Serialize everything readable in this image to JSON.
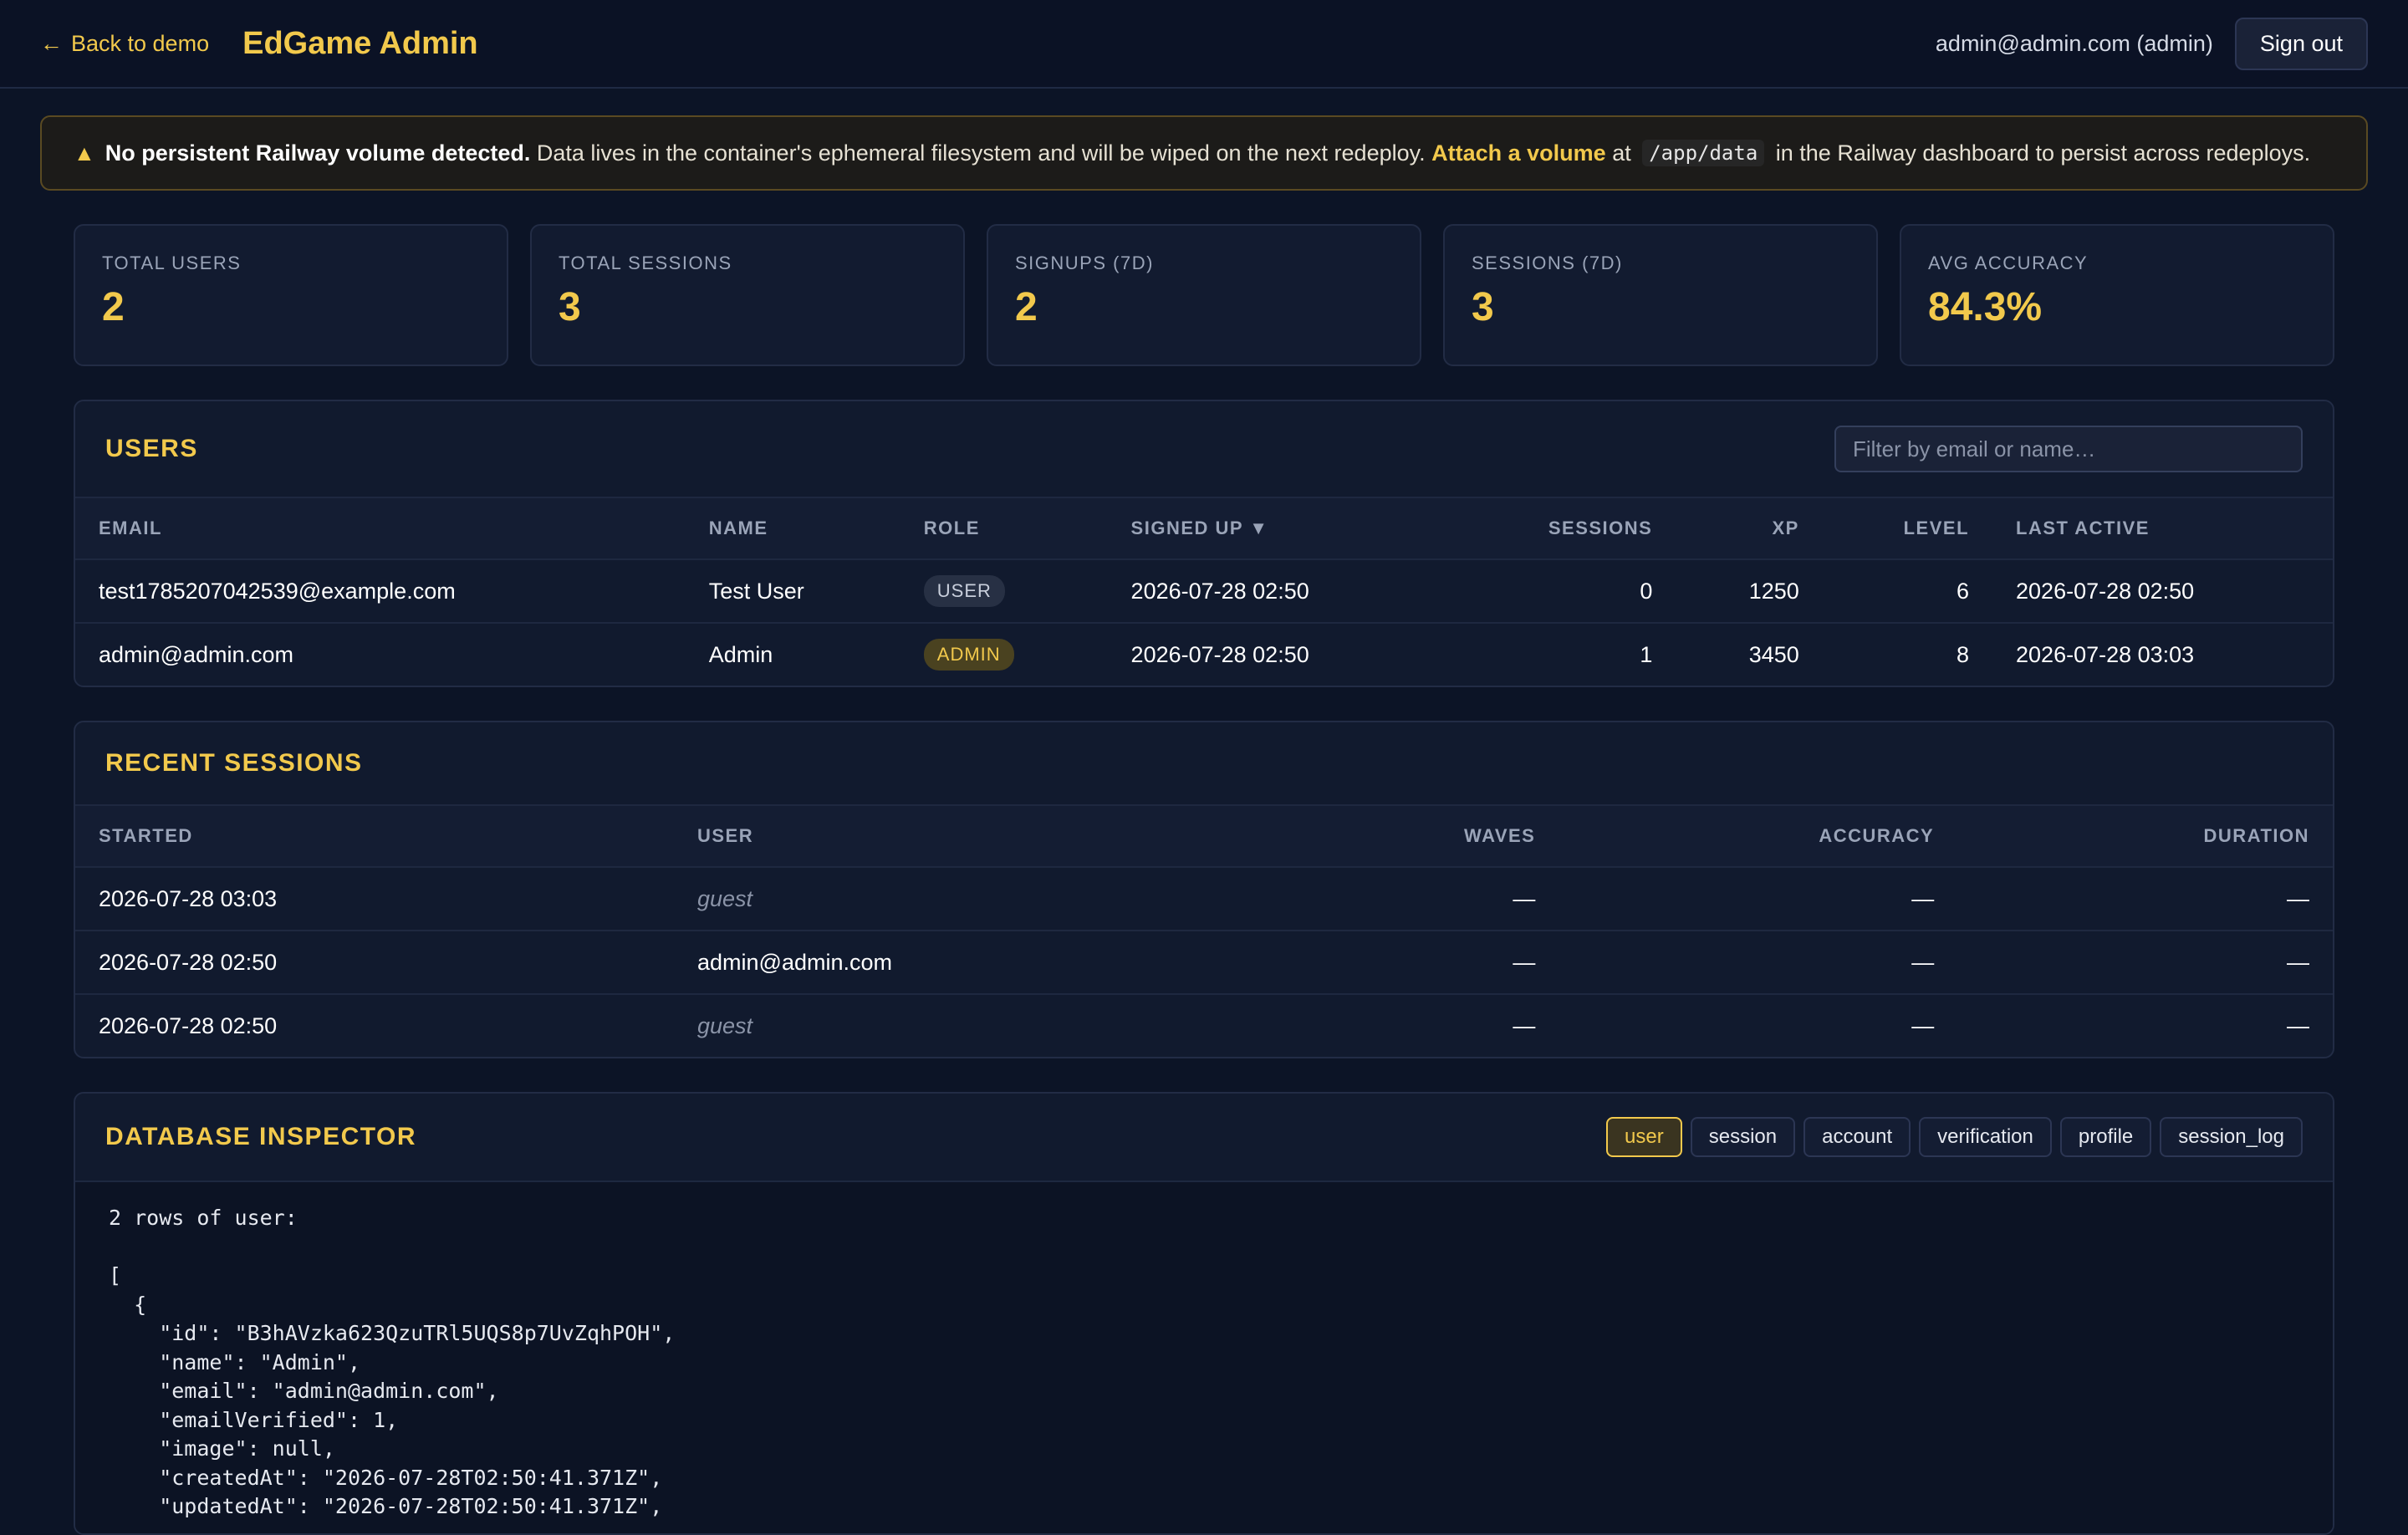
{
  "header": {
    "back_label": "Back to demo",
    "title": "EdGame Admin",
    "user_label": "admin@admin.com (admin)",
    "signout_label": "Sign out"
  },
  "banner": {
    "bold": "No persistent Railway volume detected.",
    "text1": " Data lives in the container's ephemeral filesystem and will be wiped on the next redeploy. ",
    "link": "Attach a volume",
    "text2": " at ",
    "code": "/app/data",
    "text3": " in the Railway dashboard to persist across redeploys."
  },
  "stats": [
    {
      "label": "TOTAL USERS",
      "value": "2"
    },
    {
      "label": "TOTAL SESSIONS",
      "value": "3"
    },
    {
      "label": "SIGNUPS (7D)",
      "value": "2"
    },
    {
      "label": "SESSIONS (7D)",
      "value": "3"
    },
    {
      "label": "AVG ACCURACY",
      "value": "84.3%"
    }
  ],
  "users": {
    "title": "USERS",
    "filter_placeholder": "Filter by email or name…",
    "columns": [
      "EMAIL",
      "NAME",
      "ROLE",
      "SIGNED UP ▼",
      "SESSIONS",
      "XP",
      "LEVEL",
      "LAST ACTIVE"
    ],
    "rows": [
      {
        "email": "test1785207042539@example.com",
        "name": "Test User",
        "role": "USER",
        "signed_up": "2026-07-28 02:50",
        "sessions": "0",
        "xp": "1250",
        "level": "6",
        "last_active": "2026-07-28 02:50"
      },
      {
        "email": "admin@admin.com",
        "name": "Admin",
        "role": "ADMIN",
        "signed_up": "2026-07-28 02:50",
        "sessions": "1",
        "xp": "3450",
        "level": "8",
        "last_active": "2026-07-28 03:03"
      }
    ]
  },
  "sessions": {
    "title": "RECENT SESSIONS",
    "columns": [
      "STARTED",
      "USER",
      "WAVES",
      "ACCURACY",
      "DURATION"
    ],
    "rows": [
      {
        "started": "2026-07-28 03:03",
        "user": "guest",
        "waves": "—",
        "accuracy": "—",
        "duration": "—"
      },
      {
        "started": "2026-07-28 02:50",
        "user": "admin@admin.com",
        "waves": "—",
        "accuracy": "—",
        "duration": "—"
      },
      {
        "started": "2026-07-28 02:50",
        "user": "guest",
        "waves": "—",
        "accuracy": "—",
        "duration": "—"
      }
    ]
  },
  "inspector": {
    "title": "DATABASE INSPECTOR",
    "tabs": [
      "user",
      "session",
      "account",
      "verification",
      "profile",
      "session_log"
    ],
    "active_tab": "user",
    "output": "2 rows of user:\n\n[\n  {\n    \"id\": \"B3hAVzka623QzuTRl5UQS8p7UvZqhPOH\",\n    \"name\": \"Admin\",\n    \"email\": \"admin@admin.com\",\n    \"emailVerified\": 1,\n    \"image\": null,\n    \"createdAt\": \"2026-07-28T02:50:41.371Z\",\n    \"updatedAt\": \"2026-07-28T02:50:41.371Z\","
  },
  "colors": {
    "accent": "#f2c94c",
    "background": "#0c1426",
    "panel": "#111a2e"
  }
}
